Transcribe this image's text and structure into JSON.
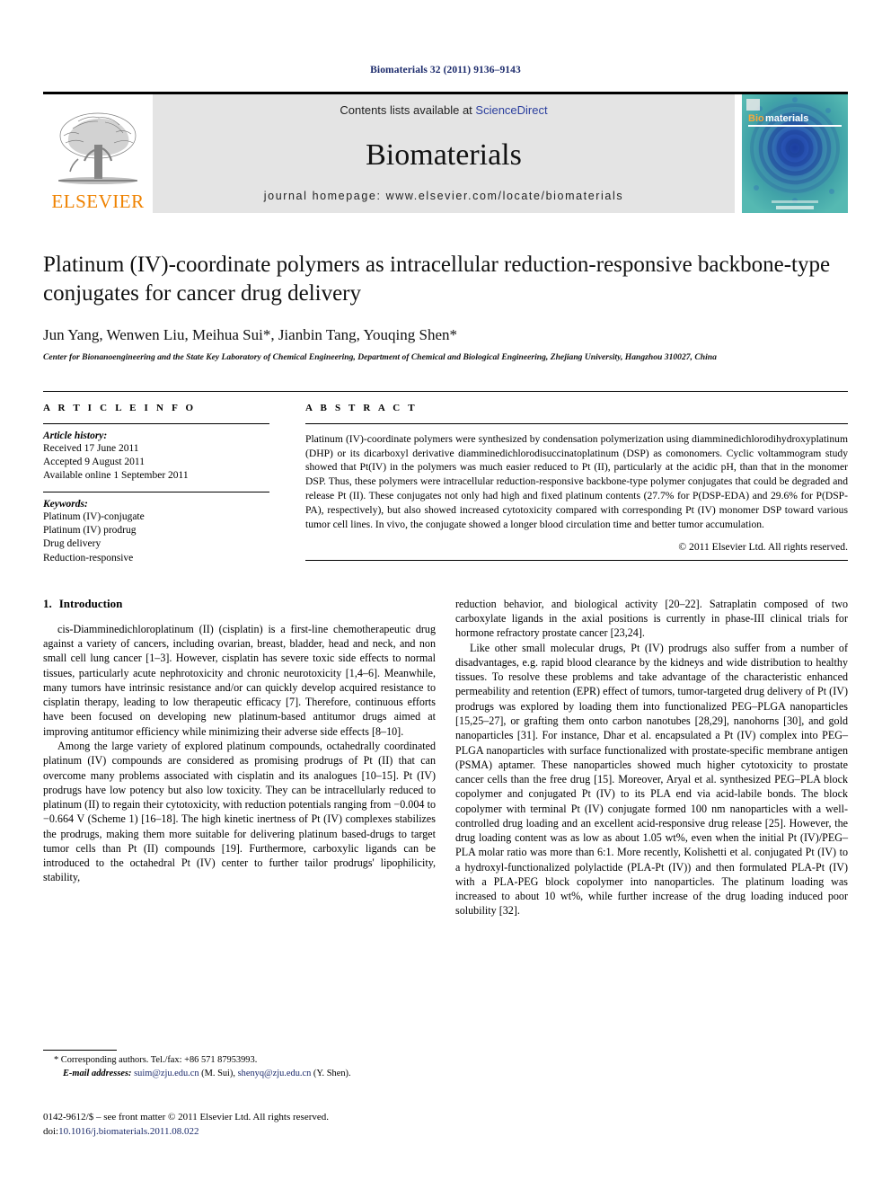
{
  "running_head": "Biomaterials 32 (2011) 9136–9143",
  "masthead": {
    "publisher_name": "ELSEVIER",
    "contents_prefix": "Contents lists available at ",
    "contents_link": "ScienceDirect",
    "journal_name": "Biomaterials",
    "homepage": "journal homepage: www.elsevier.com/locate/biomaterials",
    "cover_title_first": "Bio",
    "cover_title_rest": "materials",
    "accent_color": "#ef8200",
    "link_color": "#2b3f9e",
    "band_color": "#e4e4e4",
    "cover_color": "#3a9aa0"
  },
  "title": "Platinum (IV)-coordinate polymers as intracellular reduction-responsive backbone-type conjugates for cancer drug delivery",
  "authors": "Jun Yang, Wenwen Liu, Meihua Sui*, Jianbin Tang, Youqing Shen*",
  "affiliation": "Center for Bionanoengineering and the State Key Laboratory of Chemical Engineering, Department of Chemical and Biological Engineering, Zhejiang University, Hangzhou 310027, China",
  "article_info": {
    "heading": "A R T I C L E   I N F O",
    "history_label": "Article history:",
    "history": [
      "Received 17 June 2011",
      "Accepted 9 August 2011",
      "Available online 1 September 2011"
    ],
    "keywords_label": "Keywords:",
    "keywords": [
      "Platinum (IV)-conjugate",
      "Platinum (IV) prodrug",
      "Drug delivery",
      "Reduction-responsive"
    ]
  },
  "abstract": {
    "heading": "A B S T R A C T",
    "text": "Platinum (IV)-coordinate polymers were synthesized by condensation polymerization using diamminedichlorodihydroxyplatinum (DHP) or its dicarboxyl derivative diamminedichlorodisuccinatoplatinum (DSP) as comonomers. Cyclic voltammogram study showed that Pt(IV) in the polymers was much easier reduced to Pt (II), particularly at the acidic pH, than that in the monomer DSP. Thus, these polymers were intracellular reduction-responsive backbone-type polymer conjugates that could be degraded and release Pt (II). These conjugates not only had high and fixed platinum contents (27.7% for P(DSP-EDA) and 29.6% for P(DSP-PA), respectively), but also showed increased cytotoxicity compared with corresponding Pt (IV) monomer DSP toward various tumor cell lines. In vivo, the conjugate showed a longer blood circulation time and better tumor accumulation.",
    "copyright": "© 2011 Elsevier Ltd. All rights reserved."
  },
  "section": {
    "number": "1.",
    "title": "Introduction"
  },
  "body": {
    "left_paragraphs": [
      "cis-Diamminedichloroplatinum (II) (cisplatin) is a first-line chemotherapeutic drug against a variety of cancers, including ovarian, breast, bladder, head and neck, and non small cell lung cancer [1–3]. However, cisplatin has severe toxic side effects to normal tissues, particularly acute nephrotoxicity and chronic neurotoxicity [1,4–6]. Meanwhile, many tumors have intrinsic resistance and/or can quickly develop acquired resistance to cisplatin therapy, leading to low therapeutic efficacy [7]. Therefore, continuous efforts have been focused on developing new platinum-based antitumor drugs aimed at improving antitumor efficiency while minimizing their adverse side effects [8–10].",
      "Among the large variety of explored platinum compounds, octahedrally coordinated platinum (IV) compounds are considered as promising prodrugs of Pt (II) that can overcome many problems associated with cisplatin and its analogues [10–15]. Pt (IV) prodrugs have low potency but also low toxicity. They can be intracellularly reduced to platinum (II) to regain their cytotoxicity, with reduction potentials ranging from −0.004 to −0.664 V (Scheme 1) [16–18]. The high kinetic inertness of Pt (IV) complexes stabilizes the prodrugs, making them more suitable for delivering platinum based-drugs to target tumor cells than Pt (II) compounds [19]. Furthermore, carboxylic ligands can be introduced to the octahedral Pt (IV) center to further tailor prodrugs' lipophilicity, stability,"
    ],
    "right_paragraphs": [
      "reduction behavior, and biological activity [20–22]. Satraplatin composed of two carboxylate ligands in the axial positions is currently in phase-III clinical trials for hormone refractory prostate cancer [23,24].",
      "Like other small molecular drugs, Pt (IV) prodrugs also suffer from a number of disadvantages, e.g. rapid blood clearance by the kidneys and wide distribution to healthy tissues. To resolve these problems and take advantage of the characteristic enhanced permeability and retention (EPR) effect of tumors, tumor-targeted drug delivery of Pt (IV) prodrugs was explored by loading them into functionalized PEG–PLGA nanoparticles [15,25–27], or grafting them onto carbon nanotubes [28,29], nanohorns [30], and gold nanoparticles [31]. For instance, Dhar et al. encapsulated a Pt (IV) complex into PEG–PLGA nanoparticles with surface functionalized with prostate-specific membrane antigen (PSMA) aptamer. These nanoparticles showed much higher cytotoxicity to prostate cancer cells than the free drug [15]. Moreover, Aryal et al. synthesized PEG–PLA block copolymer and conjugated Pt (IV) to its PLA end via acid-labile bonds. The block copolymer with terminal Pt (IV) conjugate formed 100 nm nanoparticles with a well-controlled drug loading and an excellent acid-responsive drug release [25]. However, the drug loading content was as low as about 1.05 wt%, even when the initial Pt (IV)/PEG–PLA molar ratio was more than 6:1. More recently, Kolishetti et al. conjugated Pt (IV) to a hydroxyl-functionalized polylactide (PLA-Pt (IV)) and then formulated PLA-Pt (IV) with a PLA-PEG block copolymer into nanoparticles. The platinum loading was increased to about 10 wt%, while further increase of the drug loading induced poor solubility [32]."
    ]
  },
  "footnote": {
    "corresponding": "* Corresponding authors. Tel./fax: +86 571 87953993.",
    "email_label": "E-mail addresses:",
    "email_1": "suim@zju.edu.cn",
    "email_1_name": " (M. Sui), ",
    "email_2": "shenyq@zju.edu.cn",
    "email_2_name": " (Y. Shen)."
  },
  "issn": {
    "line1": "0142-9612/$ – see front matter © 2011 Elsevier Ltd. All rights reserved.",
    "doi_prefix": "doi:",
    "doi": "10.1016/j.biomaterials.2011.08.022"
  }
}
